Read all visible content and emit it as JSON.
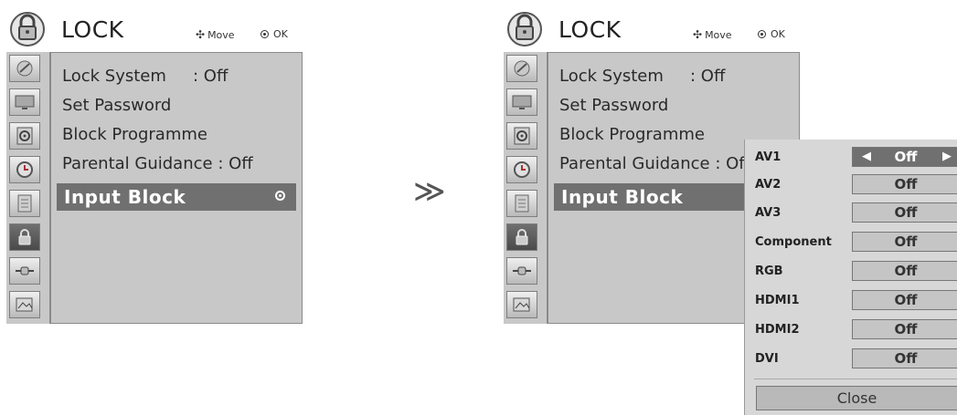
{
  "left": {
    "title": "LOCK",
    "hint_move": "Move",
    "hint_ok": "OK",
    "items": [
      {
        "label": "Lock System",
        "value": ": Off"
      },
      {
        "label": "Set Password",
        "value": ""
      },
      {
        "label": "Block Programme",
        "value": ""
      },
      {
        "label": "Parental Guidance",
        "value": ": Off"
      }
    ],
    "selected_item": "Input Block"
  },
  "right": {
    "title": "LOCK",
    "hint_move": "Move",
    "hint_ok": "OK",
    "items": [
      {
        "label": "Lock System",
        "value": ": Off"
      },
      {
        "label": "Set Password",
        "value": ""
      },
      {
        "label": "Block Programme",
        "value": ""
      },
      {
        "label": "Parental Guidance",
        "value": ": Off"
      }
    ],
    "selected_item": "Input Block"
  },
  "separator": "≫",
  "input_block": {
    "rows": [
      {
        "label": "AV1",
        "value": "Off"
      },
      {
        "label": "AV2",
        "value": "Off"
      },
      {
        "label": "AV3",
        "value": "Off"
      },
      {
        "label": "Component",
        "value": "Off"
      },
      {
        "label": "RGB",
        "value": "Off"
      },
      {
        "label": "HDMI1",
        "value": "Off"
      },
      {
        "label": "HDMI2",
        "value": "Off"
      },
      {
        "label": "DVI",
        "value": "Off"
      }
    ],
    "close_label": "Close"
  },
  "sidebar_icons": [
    "satellite-dish-icon",
    "monitor-icon",
    "speaker-icon",
    "clock-icon",
    "document-icon",
    "lock-icon",
    "input-plug-icon",
    "photo-icon"
  ]
}
